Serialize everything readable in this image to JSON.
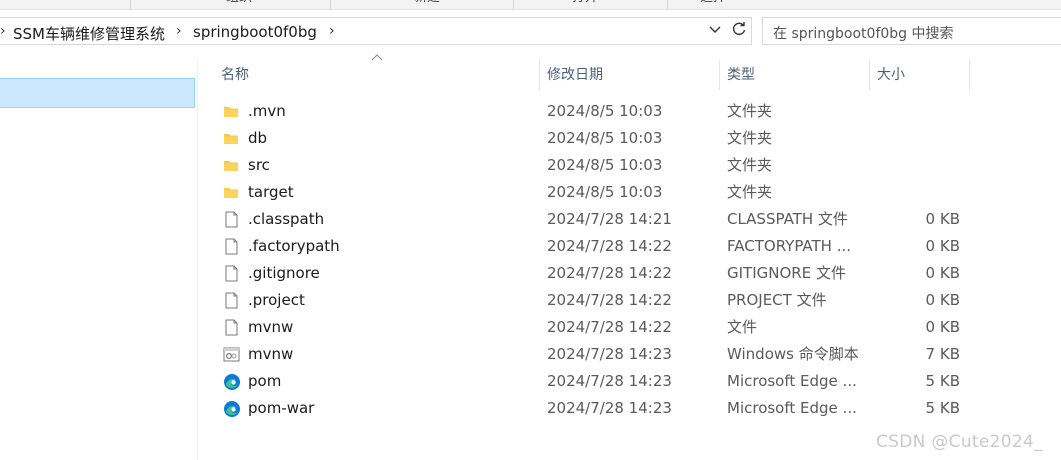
{
  "ribbon": {
    "items": [
      "组织",
      "新建",
      "打开",
      "选择"
    ]
  },
  "address": {
    "breadcrumbs": [
      "SSM车辆维修管理系统",
      "springboot0f0bg"
    ],
    "search_placeholder": "在 springboot0f0bg 中搜索"
  },
  "columns": {
    "name": "名称",
    "date": "修改日期",
    "type": "类型",
    "size": "大小"
  },
  "files": [
    {
      "name": ".mvn",
      "date": "2024/8/5 10:03",
      "type": "文件夹",
      "size": "",
      "icon": "folder-icon"
    },
    {
      "name": "db",
      "date": "2024/8/5 10:03",
      "type": "文件夹",
      "size": "",
      "icon": "folder-icon"
    },
    {
      "name": "src",
      "date": "2024/8/5 10:03",
      "type": "文件夹",
      "size": "",
      "icon": "folder-icon"
    },
    {
      "name": "target",
      "date": "2024/8/5 10:03",
      "type": "文件夹",
      "size": "",
      "icon": "folder-icon"
    },
    {
      "name": ".classpath",
      "date": "2024/7/28 14:21",
      "type": "CLASSPATH 文件",
      "size": "0 KB",
      "icon": "file-icon"
    },
    {
      "name": ".factorypath",
      "date": "2024/7/28 14:22",
      "type": "FACTORYPATH ...",
      "size": "0 KB",
      "icon": "file-icon"
    },
    {
      "name": ".gitignore",
      "date": "2024/7/28 14:22",
      "type": "GITIGNORE 文件",
      "size": "0 KB",
      "icon": "file-icon"
    },
    {
      "name": ".project",
      "date": "2024/7/28 14:22",
      "type": "PROJECT 文件",
      "size": "0 KB",
      "icon": "file-icon"
    },
    {
      "name": "mvnw",
      "date": "2024/7/28 14:22",
      "type": "文件",
      "size": "0 KB",
      "icon": "file-icon"
    },
    {
      "name": "mvnw",
      "date": "2024/7/28 14:23",
      "type": "Windows 命令脚本",
      "size": "7 KB",
      "icon": "script-icon"
    },
    {
      "name": "pom",
      "date": "2024/7/28 14:23",
      "type": "Microsoft Edge ...",
      "size": "5 KB",
      "icon": "edge-icon"
    },
    {
      "name": "pom-war",
      "date": "2024/7/28 14:23",
      "type": "Microsoft Edge ...",
      "size": "5 KB",
      "icon": "edge-icon"
    }
  ],
  "watermark": "CSDN @Cute2024_",
  "colors": {
    "folder": "#f8c94a",
    "selection": "#cce8ff",
    "edge_blue": "#0c7bd8",
    "edge_green": "#3cc48c"
  }
}
